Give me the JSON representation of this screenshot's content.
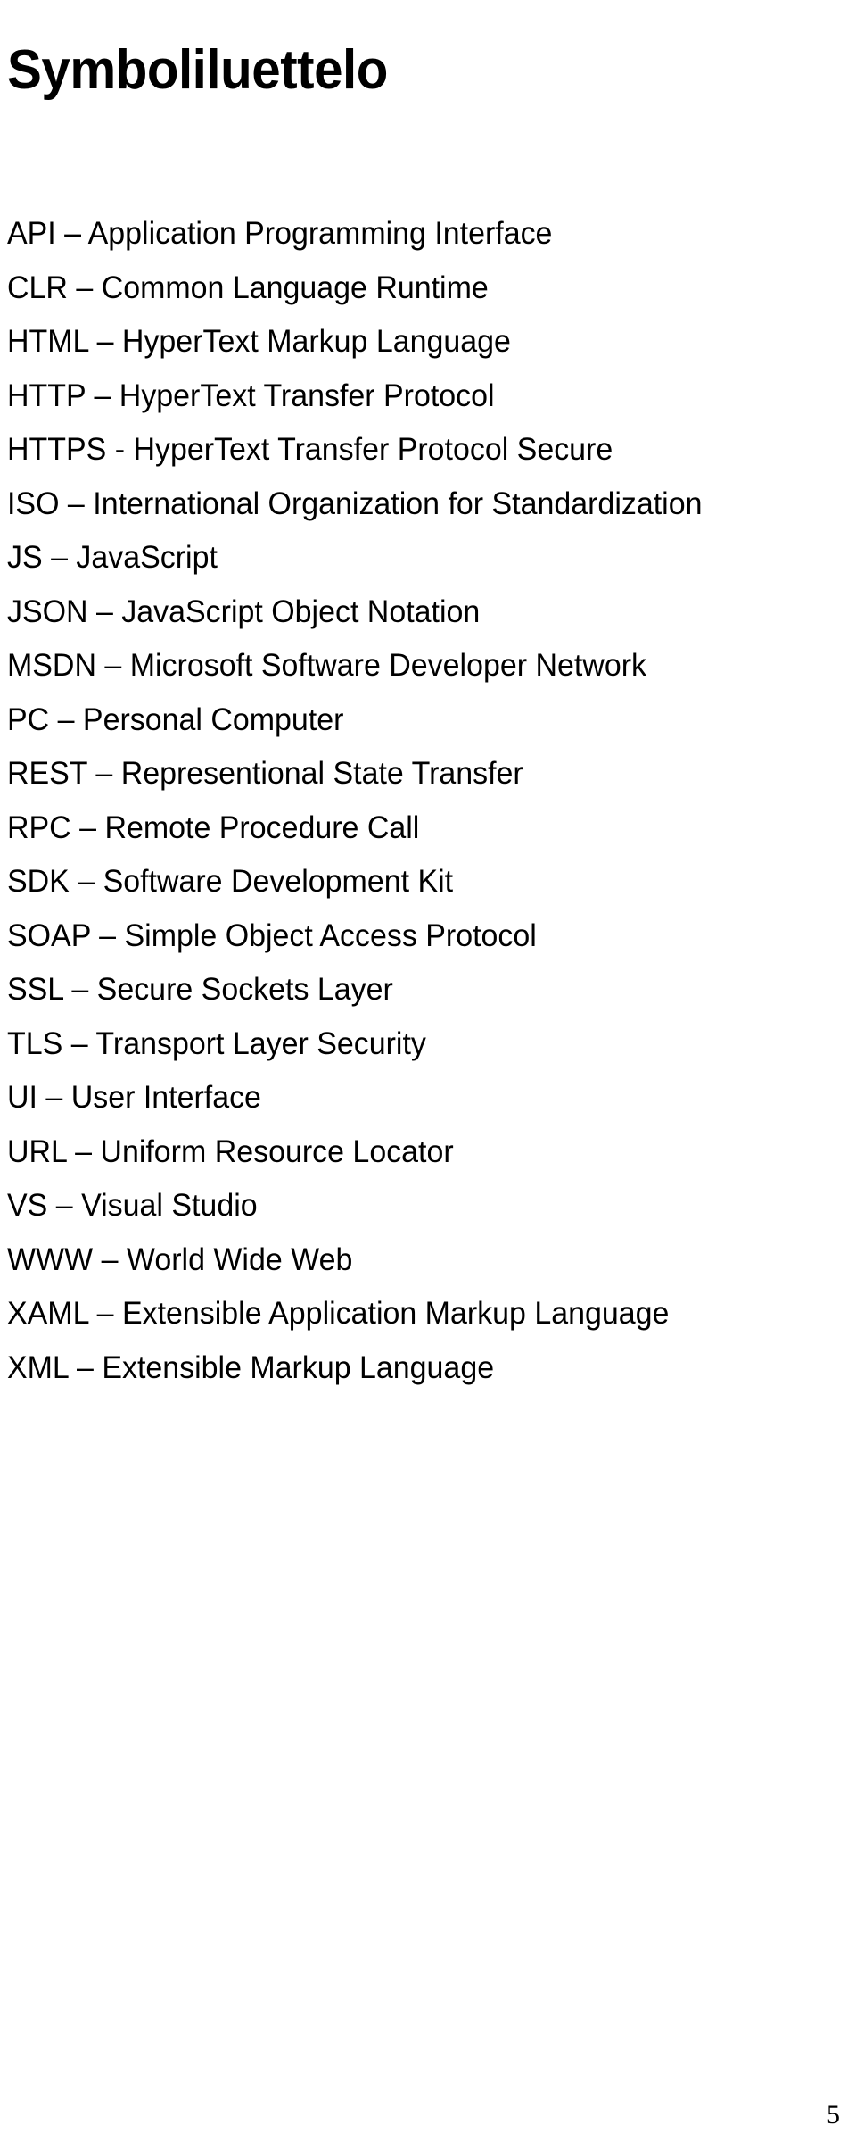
{
  "document": {
    "title": "Symboliluettelo",
    "page_number": "5",
    "text_color": "#000000",
    "background_color": "#ffffff"
  },
  "abbreviations": [
    {
      "term": "API",
      "separator": "–",
      "expansion": "Application Programming Interface"
    },
    {
      "term": "CLR",
      "separator": "–",
      "expansion": "Common Language Runtime"
    },
    {
      "term": "HTML",
      "separator": "–",
      "expansion": "HyperText Markup Language"
    },
    {
      "term": "HTTP",
      "separator": "–",
      "expansion": "HyperText Transfer Protocol"
    },
    {
      "term": "HTTPS",
      "separator": "-",
      "expansion": "HyperText Transfer Protocol Secure"
    },
    {
      "term": "ISO",
      "separator": "–",
      "expansion": "International Organization for Standardization"
    },
    {
      "term": "JS",
      "separator": "–",
      "expansion": "JavaScript"
    },
    {
      "term": "JSON",
      "separator": "–",
      "expansion": "JavaScript Object Notation"
    },
    {
      "term": "MSDN",
      "separator": "–",
      "expansion": "Microsoft Software Developer Network"
    },
    {
      "term": "PC",
      "separator": "–",
      "expansion": "Personal Computer"
    },
    {
      "term": "REST",
      "separator": "–",
      "expansion": "Representional State Transfer"
    },
    {
      "term": "RPC",
      "separator": "–",
      "expansion": "Remote Procedure Call"
    },
    {
      "term": "SDK",
      "separator": "–",
      "expansion": "Software Development Kit"
    },
    {
      "term": "SOAP",
      "separator": "–",
      "expansion": "Simple Object Access Protocol"
    },
    {
      "term": "SSL",
      "separator": "–",
      "expansion": "Secure Sockets Layer"
    },
    {
      "term": "TLS",
      "separator": "–",
      "expansion": "Transport Layer Security"
    },
    {
      "term": "UI",
      "separator": "–",
      "expansion": "User Interface"
    },
    {
      "term": "URL",
      "separator": "–",
      "expansion": "Uniform Resource Locator"
    },
    {
      "term": "VS",
      "separator": "–",
      "expansion": "Visual Studio"
    },
    {
      "term": "WWW",
      "separator": "–",
      "expansion": "World Wide Web"
    },
    {
      "term": "XAML",
      "separator": "–",
      "expansion": "Extensible Application Markup Language"
    },
    {
      "term": "XML",
      "separator": "–",
      "expansion": "Extensible Markup Language"
    }
  ]
}
